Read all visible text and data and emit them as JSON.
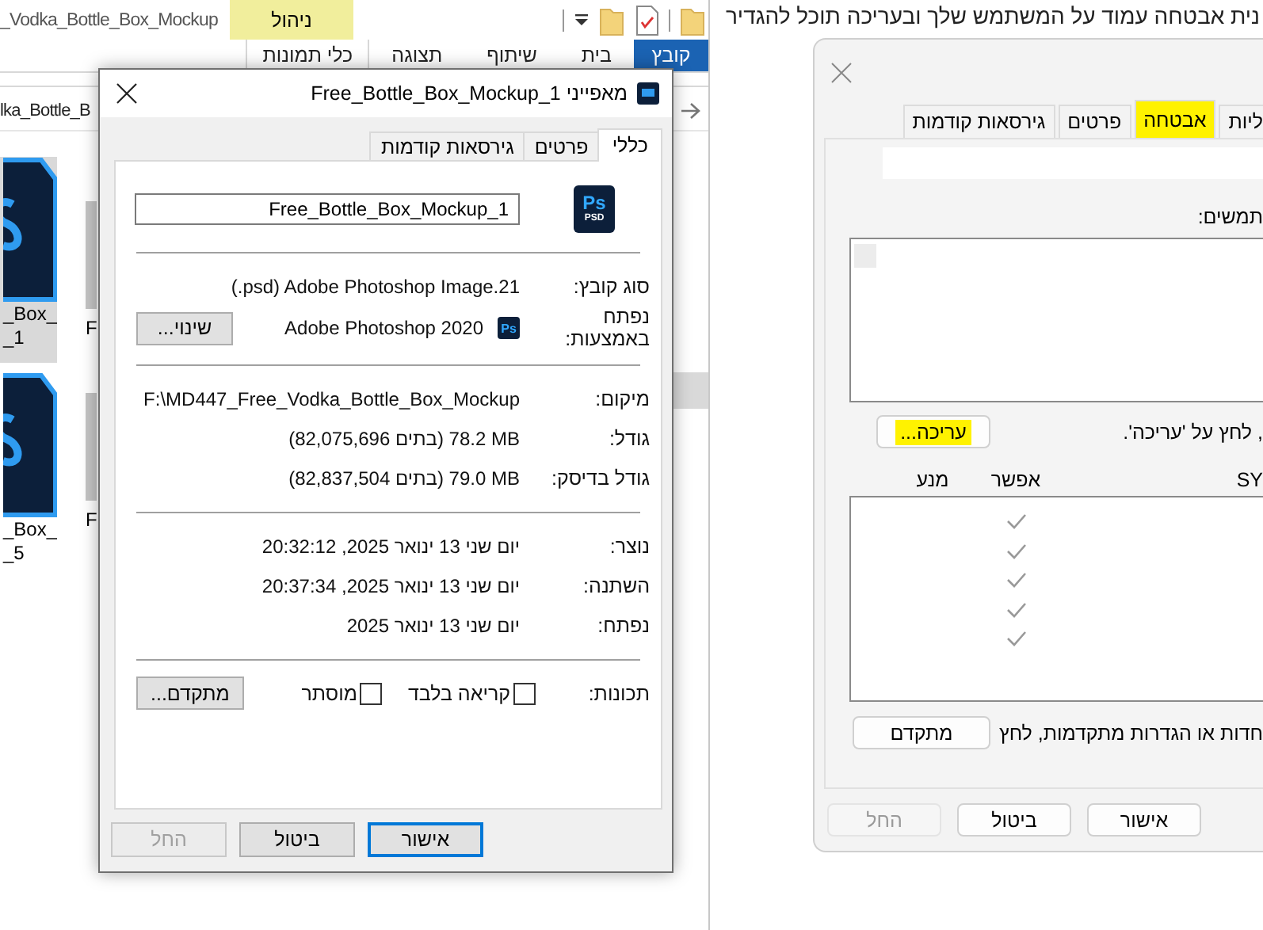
{
  "explorer": {
    "title": "_Vodka_Bottle_Box_Mockup",
    "context_group": "ניהול",
    "ribbon_tabs": [
      {
        "label": "קובץ",
        "kind": "file"
      },
      {
        "label": "בית",
        "kind": "tab"
      },
      {
        "label": "שיתוף",
        "kind": "tab"
      },
      {
        "label": "תצוגה",
        "kind": "tab"
      },
      {
        "label": "כלי תמונות",
        "kind": "context"
      }
    ],
    "address": "lka_Bottle_B",
    "files": [
      {
        "label": "_Box_\n_1",
        "selected": true
      },
      {
        "label": "_Box_\n_5",
        "selected": false
      }
    ],
    "files_column_2": [
      {
        "label": "F"
      },
      {
        "label": "F"
      }
    ]
  },
  "properties_dialog": {
    "title": "מאפייני Free_Bottle_Box_Mockup_1",
    "tabs": [
      {
        "label": "כללי",
        "selected": true
      },
      {
        "label": "פרטים",
        "selected": false
      },
      {
        "label": "גירסאות קודמות",
        "selected": false
      }
    ],
    "file_icon": {
      "label": "Ps",
      "sublabel": "PSD"
    },
    "file_name": "Free_Bottle_Box_Mockup_1",
    "sections": [
      [
        {
          "kind": "text_ltr",
          "label": "סוג קובץ:",
          "value": "(.psd) Adobe Photoshop Image.21"
        },
        {
          "kind": "app",
          "label": "נפתח באמצעות:",
          "value": "Adobe Photoshop 2020",
          "icon_label": "Ps",
          "button": "שינוי..."
        }
      ],
      [
        {
          "kind": "text",
          "label": "מיקום:",
          "value": "F:\\MD447_Free_Vodka_Bottle_Box_Mockup"
        },
        {
          "kind": "text_ltr",
          "label": "גודל:",
          "value": "(82,075,696 בתים) 78.2 MB"
        },
        {
          "kind": "text_ltr",
          "label": "גודל בדיסק:",
          "value": "(82,837,504 בתים) 79.0 MB"
        }
      ],
      [
        {
          "kind": "text",
          "label": "נוצר:",
          "value": "יום שני 13 ינואר 2025, 20:32:12"
        },
        {
          "kind": "text",
          "label": "השתנה:",
          "value": "יום שני 13 ינואר 2025, 20:37:34"
        },
        {
          "kind": "text",
          "label": "נפתח:",
          "value": "יום שני 13 ינואר 2025"
        }
      ],
      [
        {
          "kind": "attributes",
          "label": "תכונות:",
          "checkboxes": [
            {
              "label": "קריאה בלבד",
              "checked": false
            },
            {
              "label": "מוסתר",
              "checked": false
            }
          ],
          "button": "מתקדם..."
        }
      ]
    ],
    "buttons": [
      {
        "label": "אישור",
        "default": true,
        "disabled": false
      },
      {
        "label": "ביטול",
        "default": false,
        "disabled": false
      },
      {
        "label": "החל",
        "default": false,
        "disabled": true
      }
    ]
  },
  "page_text": "נית אבטחה עמוד על המשתמש שלך ובעריכה תוכל להגדיר",
  "security_dialog": {
    "tabs": [
      {
        "label": "ליות",
        "selected": false,
        "highlighted": false
      },
      {
        "label": "אבטחה",
        "selected": true,
        "highlighted": true
      },
      {
        "label": "פרטים",
        "selected": false,
        "highlighted": false
      },
      {
        "label": "גירסאות קודמות",
        "selected": false,
        "highlighted": false
      }
    ],
    "users_label": "תמשים:",
    "edit_hint": ", לחץ על 'עריכה'.",
    "edit_button": {
      "label": "עריכה...",
      "highlighted": true
    },
    "permission_columns": [
      "SY",
      "אפשר",
      "מנע"
    ],
    "permissions": [
      {
        "allow": true,
        "deny": false
      },
      {
        "allow": true,
        "deny": false
      },
      {
        "allow": true,
        "deny": false
      },
      {
        "allow": true,
        "deny": false
      },
      {
        "allow": true,
        "deny": false
      }
    ],
    "advanced_hint": "חדות או הגדרות מתקדמות, לחץ",
    "advanced_button": "מתקדם",
    "buttons": [
      {
        "label": "אישור",
        "disabled": false
      },
      {
        "label": "ביטול",
        "disabled": false
      },
      {
        "label": "החל",
        "disabled": true
      }
    ]
  }
}
